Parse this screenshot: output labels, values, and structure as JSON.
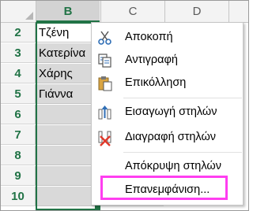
{
  "sheet": {
    "columns": [
      "B",
      "C",
      "D"
    ],
    "rows": [
      "2",
      "3",
      "4",
      "5",
      "6",
      "7",
      "8",
      "9",
      "10"
    ],
    "column_b_values": [
      "Τζένη",
      "Κατερίνα",
      "Χάρης",
      "Γιάννα",
      "",
      "",
      "",
      "",
      ""
    ]
  },
  "context_menu": {
    "items": [
      {
        "label": "Αποκοπή",
        "icon": "scissors-icon"
      },
      {
        "label": "Αντιγραφή",
        "icon": "copy-icon"
      },
      {
        "label": "Επικόλληση",
        "icon": "paste-icon"
      },
      {
        "label": "Εισαγωγή στηλών",
        "icon": "insert-columns-icon"
      },
      {
        "label": "Διαγραφή στηλών",
        "icon": "delete-columns-icon"
      },
      {
        "label": "Απόκρυψη στηλών",
        "icon": ""
      },
      {
        "label": "Επανεμφάνιση...",
        "icon": ""
      }
    ]
  },
  "colors": {
    "excel_green": "#217346",
    "highlight_magenta": "#ff3ef0",
    "delete_red": "#e0392b",
    "icon_blue": "#2f6eb5"
  }
}
